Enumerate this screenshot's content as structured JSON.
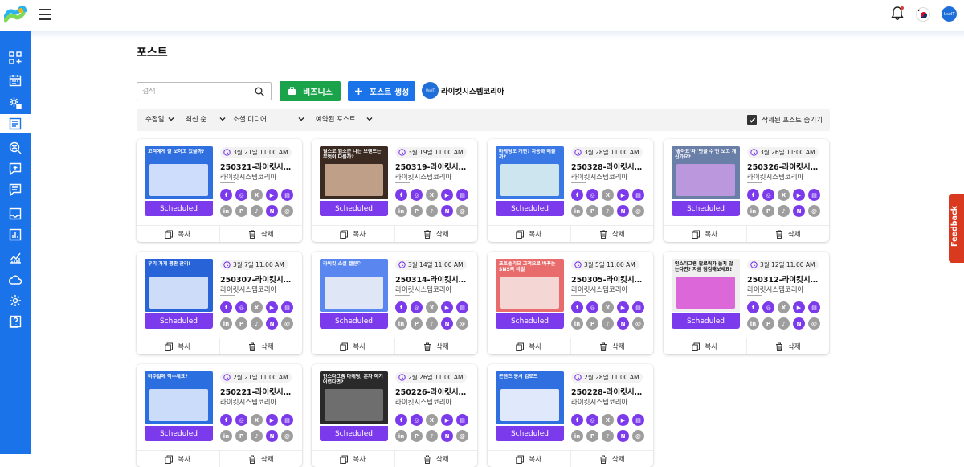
{
  "header": {
    "menu_icon": "hamburger-icon",
    "notification_icon": "bell-icon",
    "language_icon": "korea-flag-icon",
    "avatar_text": "UseIT"
  },
  "sidebar": {
    "items": [
      {
        "name": "dashboard",
        "icon": "grid-plus-icon"
      },
      {
        "name": "calendar",
        "icon": "calendar-icon"
      },
      {
        "name": "settings-user",
        "icon": "gear-person-icon"
      },
      {
        "name": "posts",
        "icon": "post-icon",
        "active": true
      },
      {
        "name": "explore",
        "icon": "search-globe-icon"
      },
      {
        "name": "add-message",
        "icon": "chat-plus-icon"
      },
      {
        "name": "messages",
        "icon": "chat-icon"
      },
      {
        "name": "inbox",
        "icon": "inbox-icon"
      },
      {
        "name": "reports",
        "icon": "bar-chart-icon"
      },
      {
        "name": "analytics",
        "icon": "line-chart-icon"
      },
      {
        "name": "cloud",
        "icon": "cloud-icon"
      },
      {
        "name": "settings",
        "icon": "gear-icon"
      },
      {
        "name": "help",
        "icon": "help-icon"
      }
    ]
  },
  "page": {
    "title": "포스트"
  },
  "toolbar": {
    "search_placeholder": "검색",
    "business_label": "비즈니스",
    "create_label": "포스트 생성",
    "account_name": "라이킷시스템코리아",
    "account_avatar_text": "UseIT"
  },
  "filters": {
    "sort_field": "수정일",
    "sort_order": "최신 순",
    "social_media": "소셜 미디어",
    "post_type": "예약된 포스트",
    "hide_deleted_label": "삭제된 포스트 숨기기",
    "hide_deleted_checked": true
  },
  "card_labels": {
    "status": "Scheduled",
    "copy": "복사",
    "delete": "삭제"
  },
  "posts": [
    {
      "date": "3월 21일 11:00 AM",
      "title": "250321-라이킷시스템코리아",
      "account": "라이킷시스템코리아",
      "thumb_text": "고객에게 잘 보이고 있을까?"
    },
    {
      "date": "3월 19일 11:00 AM",
      "title": "250319-라이킷시스템코리아",
      "account": "라이킷시스템코리아",
      "thumb_text": "릴스로 입소문 나는 브랜드는 무엇이 다를까?"
    },
    {
      "date": "3월 28일 11:00 AM",
      "title": "250328-라이킷시스템코리아",
      "account": "라이킷시스템코리아",
      "thumb_text": "마케팅도 개편? 자동화 해볼까?"
    },
    {
      "date": "3월 26일 11:00 AM",
      "title": "250326-라이킷시스템코리아",
      "account": "라이킷시스템코리아",
      "thumb_text": "'좋아요'와 '댓글 수'만 보고 계신가요?"
    },
    {
      "date": "3월 7일 11:00 AM",
      "title": "250307-라이킷시스템코리아",
      "account": "라이킷시스템코리아",
      "thumb_text": "우리 가게 평판 관리!"
    },
    {
      "date": "3월 14일 11:00 AM",
      "title": "250314-라이킷시스템코리아",
      "account": "라이킷시스템코리아",
      "thumb_text": "라이킷 소셜 캘린더"
    },
    {
      "date": "3월 5일 11:00 AM",
      "title": "250305-라이킷시스템코리아",
      "account": "라이킷시스템코리아",
      "thumb_text": "포트폴리오 고객으로 바꾸는 SNS의 비밀"
    },
    {
      "date": "3월 12일 11:00 AM",
      "title": "250312-라이킷시스템코리아",
      "account": "라이킷시스템코리아",
      "thumb_text": "인스타그램 팔로워가 늘지 않는다면? 지금 점검해보세요!"
    },
    {
      "date": "2월 21일 11:00 AM",
      "title": "250221-라이킷시스템코리아",
      "account": "라이킷시스템코리아",
      "thumb_text": "비주얼에 착수세요?"
    },
    {
      "date": "2월 26일 11:00 AM",
      "title": "250226-라이킷시스템코리아",
      "account": "라이킷시스템코리아",
      "thumb_text": "인스타그램 마케팅, 혼자 하기 어렵다면?"
    },
    {
      "date": "2월 28일 11:00 AM",
      "title": "250228-라이킷시스템코리아",
      "account": "라이킷시스템코리아",
      "thumb_text": "콘텐츠 동시 업로드"
    }
  ],
  "social_icons_row1": [
    {
      "name": "facebook-icon",
      "glyph": "f",
      "state": "on"
    },
    {
      "name": "instagram-icon",
      "glyph": "◎",
      "state": "on"
    },
    {
      "name": "x-icon",
      "glyph": "X",
      "state": "off"
    },
    {
      "name": "youtube-icon",
      "glyph": "▶",
      "state": "on"
    },
    {
      "name": "google-business-icon",
      "glyph": "▤",
      "state": "on"
    }
  ],
  "social_icons_row2": [
    {
      "name": "linkedin-icon",
      "glyph": "in",
      "state": "off"
    },
    {
      "name": "pinterest-icon",
      "glyph": "P",
      "state": "off"
    },
    {
      "name": "tiktok-icon",
      "glyph": "♪",
      "state": "off"
    },
    {
      "name": "naver-icon",
      "glyph": "N",
      "state": "on"
    },
    {
      "name": "threads-icon",
      "glyph": "@",
      "state": "off"
    }
  ],
  "feedback": {
    "label": "Feedback"
  },
  "colors": {
    "brand_blue": "#1a73e8",
    "scheduled_purple": "#7c3aed",
    "business_green": "#1aa34a",
    "feedback_red": "#d93a1f"
  }
}
